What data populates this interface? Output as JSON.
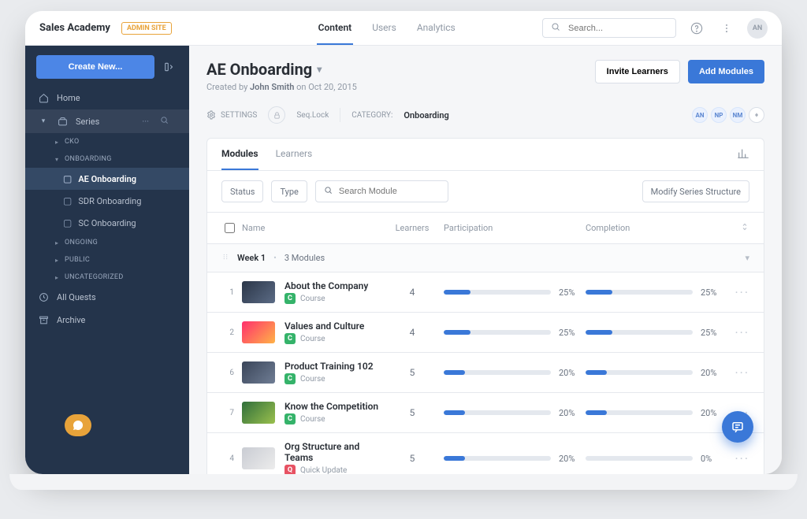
{
  "top": {
    "brand": "Sales Academy",
    "admin_badge": "ADMIN SITE",
    "tabs": {
      "content": "Content",
      "users": "Users",
      "analytics": "Analytics"
    },
    "search_placeholder": "Search...",
    "avatar_initials": "AN"
  },
  "sidebar": {
    "create_label": "Create New...",
    "home": "Home",
    "series": "Series",
    "sections": {
      "cko": "CKO",
      "onboarding": "ONBOARDING",
      "onboarding_items": {
        "ae": "AE Onboarding",
        "sdr": "SDR Onboarding",
        "sc": "SC Onboarding"
      },
      "ongoing": "ONGOING",
      "public_": "PUBLIC",
      "uncategorized": "UNCATEGORIZED"
    },
    "allquests": "All Quests",
    "archive": "Archive"
  },
  "page": {
    "title": "AE Onboarding",
    "created_prefix": "Created by",
    "created_by": "John Smith",
    "created_on_prefix": "on",
    "created_on": "Oct 20, 2015",
    "invite_label": "Invite Learners",
    "add_modules_label": "Add Modules",
    "settings_label": "SETTINGS",
    "seqlock_label": "Seq.Lock",
    "category_label": "CATEGORY:",
    "category_value": "Onboarding",
    "learner_chips": [
      "AN",
      "NP",
      "NM"
    ]
  },
  "content_tabs": {
    "modules": "Modules",
    "learners": "Learners"
  },
  "toolbar": {
    "status": "Status",
    "type": "Type",
    "search_ph": "Search Module",
    "modify": "Modify Series Structure"
  },
  "columns": {
    "name": "Name",
    "learners": "Learners",
    "participation": "Participation",
    "completion": "Completion"
  },
  "week": {
    "label": "Week 1",
    "count": "3 Modules"
  },
  "modules": [
    {
      "n": "1",
      "name": "About the Company",
      "type": "Course",
      "badge": "C",
      "learners": "4",
      "participation": 25,
      "completion": 25,
      "thumb": "linear-gradient(135deg,#2b3648,#5b6b85)"
    },
    {
      "n": "2",
      "name": "Values and Culture",
      "type": "Course",
      "badge": "C",
      "learners": "4",
      "participation": 25,
      "completion": 25,
      "thumb": "linear-gradient(135deg,#ff2f6d,#ffb347)"
    },
    {
      "n": "6",
      "name": "Product Training 102",
      "type": "Course",
      "badge": "C",
      "learners": "5",
      "participation": 20,
      "completion": 20,
      "thumb": "linear-gradient(135deg,#3a4559,#6f7d94)"
    },
    {
      "n": "7",
      "name": "Know the Competition",
      "type": "Course",
      "badge": "C",
      "learners": "5",
      "participation": 20,
      "completion": 20,
      "thumb": "linear-gradient(135deg,#2f6e3b,#9ac04d)"
    },
    {
      "n": "4",
      "name": "Org Structure and Teams",
      "type": "Quick Update",
      "badge": "Q",
      "learners": "5",
      "participation": 20,
      "completion": 0,
      "thumb": "linear-gradient(135deg,#c9ccd3,#ececec)"
    }
  ]
}
